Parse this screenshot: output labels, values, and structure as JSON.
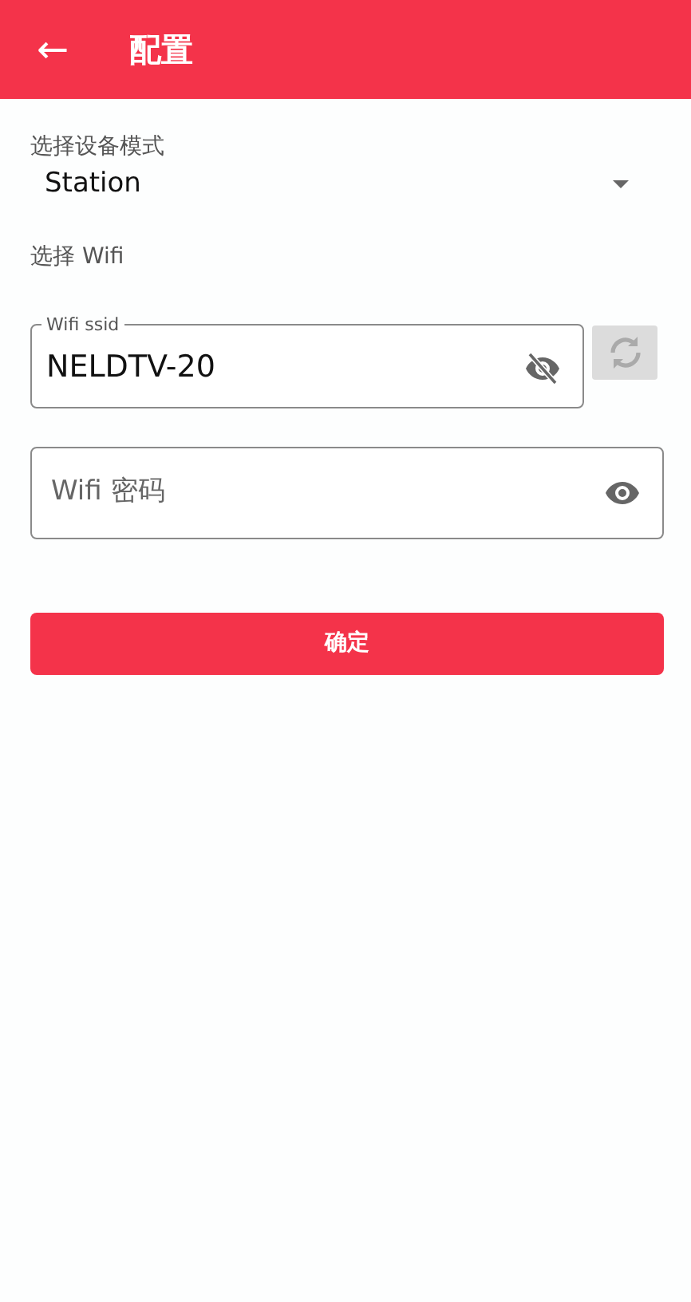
{
  "app_bar": {
    "back": "←",
    "title": "配置"
  },
  "mode": {
    "label": "选择设备模式",
    "value": "Station"
  },
  "wifi_section": {
    "label": "选择 Wifi"
  },
  "ssid_field": {
    "label": "Wifi ssid",
    "value": "NELDTV-20",
    "obscured": false
  },
  "refresh_button": {
    "disabled": true
  },
  "password_field": {
    "placeholder": "Wifi 密码",
    "obscured": true
  },
  "confirm_button": {
    "label": "确定"
  }
}
